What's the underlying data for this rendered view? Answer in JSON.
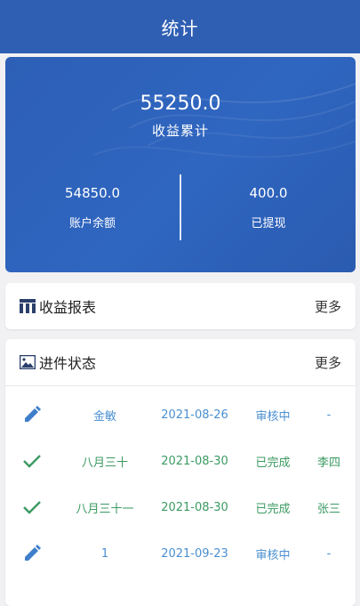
{
  "header": {
    "title": "统计"
  },
  "summary": {
    "total_value": "55250.0",
    "total_label": "收益累计",
    "balance_value": "54850.0",
    "balance_label": "账户余额",
    "withdrawn_value": "400.0",
    "withdrawn_label": "已提现"
  },
  "report": {
    "title": "收益报表",
    "more": "更多",
    "icon": "table-icon"
  },
  "progress": {
    "title": "进件状态",
    "more": "更多",
    "icon": "image-icon",
    "rows": [
      {
        "icon": "pencil-icon",
        "name": "金敏",
        "date": "2021-08-26",
        "status": "审核中",
        "person": "-",
        "tone": "blue"
      },
      {
        "icon": "check-icon",
        "name": "八月三十",
        "date": "2021-08-30",
        "status": "已完成",
        "person": "李四",
        "tone": "green"
      },
      {
        "icon": "check-icon",
        "name": "八月三十一",
        "date": "2021-08-30",
        "status": "已完成",
        "person": "张三",
        "tone": "green"
      },
      {
        "icon": "pencil-icon",
        "name": "1",
        "date": "2021-09-23",
        "status": "审核中",
        "person": "-",
        "tone": "blue"
      }
    ]
  },
  "colors": {
    "brand": "#2f5fb3",
    "pending": "#4a8fd0",
    "done": "#3c9a62"
  }
}
